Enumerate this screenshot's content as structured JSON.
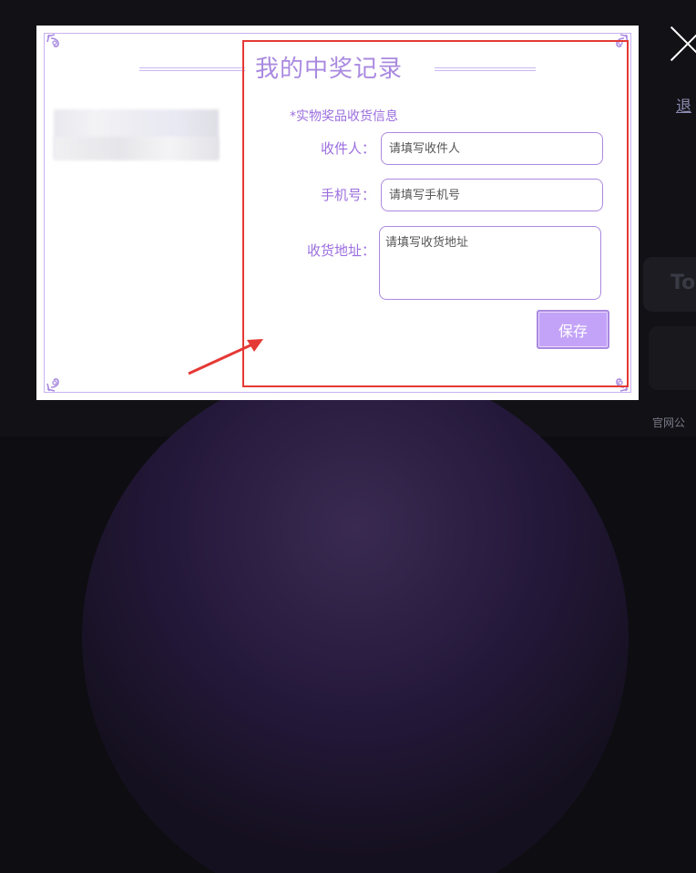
{
  "modal": {
    "title": "我的中奖记录",
    "section_label": "*实物奖品收货信息",
    "fields": {
      "receiver": {
        "label": "收件人：",
        "placeholder": "请填写收件人"
      },
      "phone": {
        "label": "手机号：",
        "placeholder": "请填写手机号"
      },
      "address": {
        "label": "收货地址：",
        "placeholder": "请填写收货地址"
      }
    },
    "save_label": "保存",
    "close_icon": "close-icon"
  },
  "background": {
    "link_text": "退",
    "button_text": "To",
    "footer_text": "官网公"
  },
  "colors": {
    "accent": "#a98ae0",
    "label": "#9b6ede",
    "button_bg": "#c3a3f7",
    "highlight": "#e53935"
  }
}
